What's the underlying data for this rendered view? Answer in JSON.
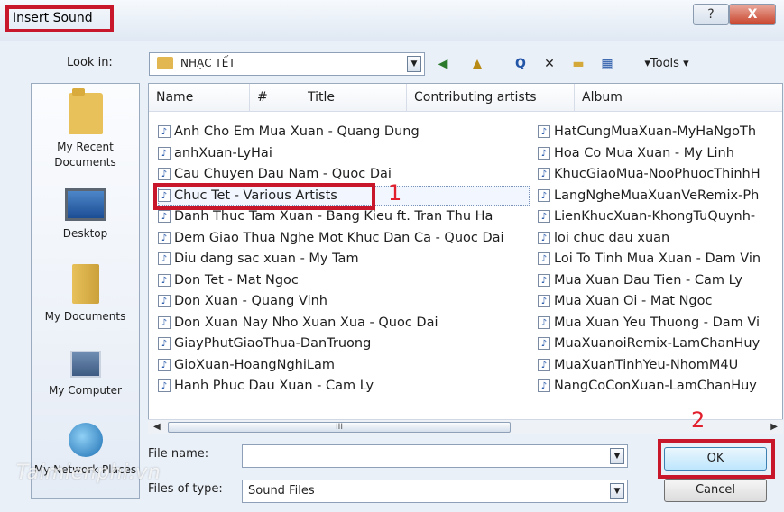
{
  "dialog": {
    "title": "Insert Sound",
    "help_glyph": "?",
    "close_glyph": "X"
  },
  "look_in": {
    "label": "Look in:",
    "value": "NHẠC TẾT"
  },
  "toolbar": {
    "back_glyph": "◀",
    "up_glyph": "▲",
    "search_glyph": "Q",
    "delete_glyph": "✕",
    "new_folder_glyph": "▬",
    "views_glyph": "▦",
    "tools_label": "Tools"
  },
  "places": [
    {
      "label": "My Recent Documents"
    },
    {
      "label": "Desktop"
    },
    {
      "label": "My Documents"
    },
    {
      "label": "My Computer"
    },
    {
      "label": "My Network Places"
    }
  ],
  "columns": [
    "Name",
    "#",
    "Title",
    "Contributing artists",
    "Album"
  ],
  "files_left": [
    "Anh Cho Em Mua Xuan - Quang Dung",
    "anhXuan-LyHai",
    "Cau Chuyen Dau Nam - Quoc Dai",
    "Chuc Tet - Various Artists",
    "Danh Thuc Tam Xuan - Bang Kieu ft. Tran Thu Ha",
    "Dem Giao Thua Nghe Mot Khuc Dan Ca - Quoc Dai",
    "Diu dang sac xuan - My Tam",
    "Don Tet - Mat Ngoc",
    "Don Xuan - Quang Vinh",
    "Don Xuan Nay Nho Xuan Xua - Quoc Dai",
    "GiayPhutGiaoThua-DanTruong",
    "GioXuan-HoangNghiLam",
    "Hanh Phuc Dau Xuan - Cam Ly"
  ],
  "files_right": [
    "HatCungMuaXuan-MyHaNgoTh",
    "Hoa Co Mua Xuan - My Linh",
    "KhucGiaoMua-NooPhuocThinhH",
    "LangNgheMuaXuanVeRemix-Ph",
    "LienKhucXuan-KhongTuQuynh-",
    "loi chuc dau xuan",
    "Loi To Tinh Mua Xuan - Dam Vin",
    "Mua Xuan Dau Tien - Cam Ly",
    "Mua Xuan Oi - Mat Ngoc",
    "Mua Xuan Yeu Thuong - Dam Vi",
    "MuaXuanoiRemix-LamChanHuy",
    "MuaXuanTinhYeu-NhomM4U",
    "NangCoConXuan-LamChanHuy"
  ],
  "note_glyph": "♪",
  "scroll_grip": "III",
  "file_name": {
    "label": "File name:",
    "value": ""
  },
  "file_type": {
    "label": "Files of type:",
    "value": "Sound Files"
  },
  "buttons": {
    "ok": "OK",
    "cancel": "Cancel"
  },
  "annotations": {
    "step1": "1",
    "step2": "2"
  },
  "watermark": "Taimienphi.vn",
  "colors": {
    "highlight_red": "#c8162a",
    "annotation_red": "#e11f2d"
  }
}
